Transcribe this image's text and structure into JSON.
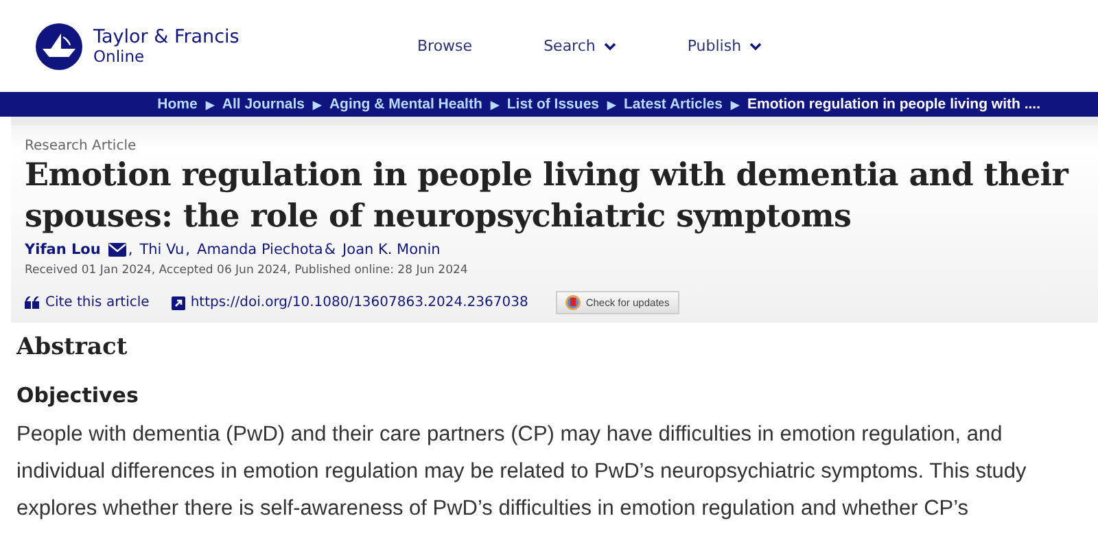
{
  "header": {
    "logo": {
      "name": "Taylor & Francis",
      "sub": "Online"
    },
    "nav": [
      {
        "label": "Browse",
        "dropdown": false
      },
      {
        "label": "Search",
        "dropdown": true
      },
      {
        "label": "Publish",
        "dropdown": true
      }
    ]
  },
  "breadcrumb": {
    "separator": "▶",
    "items": [
      {
        "label": "Home",
        "current": false
      },
      {
        "label": "All Journals",
        "current": false
      },
      {
        "label": "Aging & Mental Health",
        "current": false
      },
      {
        "label": "List of Issues",
        "current": false
      },
      {
        "label": "Latest Articles",
        "current": false
      },
      {
        "label": "Emotion regulation in people living with ....",
        "current": true
      }
    ]
  },
  "article": {
    "type": "Research Article",
    "title": "Emotion regulation in people living with dementia and their spouses: the role of neuropsychiatric symptoms",
    "authors": [
      {
        "name": "Yifan Lou",
        "corresponding": true,
        "sep": ","
      },
      {
        "name": "Thi Vu",
        "corresponding": false,
        "sep": ","
      },
      {
        "name": "Amanda Piechota",
        "corresponding": false,
        "sep": "&"
      },
      {
        "name": "Joan K. Monin",
        "corresponding": false
      }
    ],
    "dates": "Received 01 Jan 2024, Accepted 06 Jun 2024, Published online: 28 Jun 2024",
    "cite": "Cite this article",
    "doi": "https://doi.org/10.1080/13607863.2024.2367038",
    "updates": "Check for updates"
  },
  "abstract": {
    "heading": "Abstract",
    "section": "Objectives",
    "text": "People with dementia (PwD) and their care partners (CP) may have difficulties in emotion regulation, and individual differences in emotion regulation may be related to PwD’s neuropsychiatric symptoms. This study explores whether there is self-awareness of PwD’s difficulties in emotion regulation and whether CP’s"
  }
}
